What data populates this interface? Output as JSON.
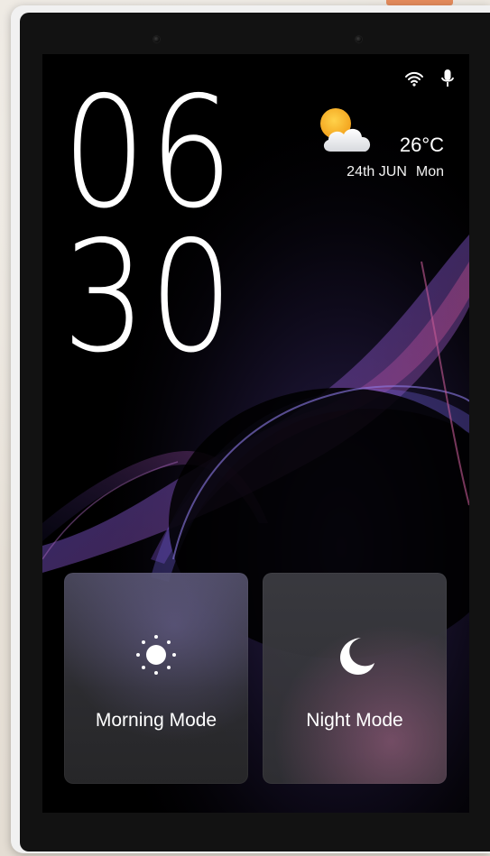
{
  "status_bar": {
    "wifi_icon": "wifi-icon",
    "mic_icon": "microphone-icon"
  },
  "clock": {
    "hours": "06",
    "minutes": "30"
  },
  "weather": {
    "icon": "partly-cloudy-icon",
    "temperature": "26°C",
    "date": "24th JUN",
    "weekday": "Mon"
  },
  "modes": [
    {
      "label": "Morning Mode",
      "icon": "sun-icon"
    },
    {
      "label": "Night Mode",
      "icon": "moon-icon"
    }
  ],
  "colors": {
    "accent_orange": "#e58c5d",
    "sun_yellow": "#f7b22e",
    "wave_purple": "#8a58c8",
    "wave_magenta": "#b0467d"
  }
}
